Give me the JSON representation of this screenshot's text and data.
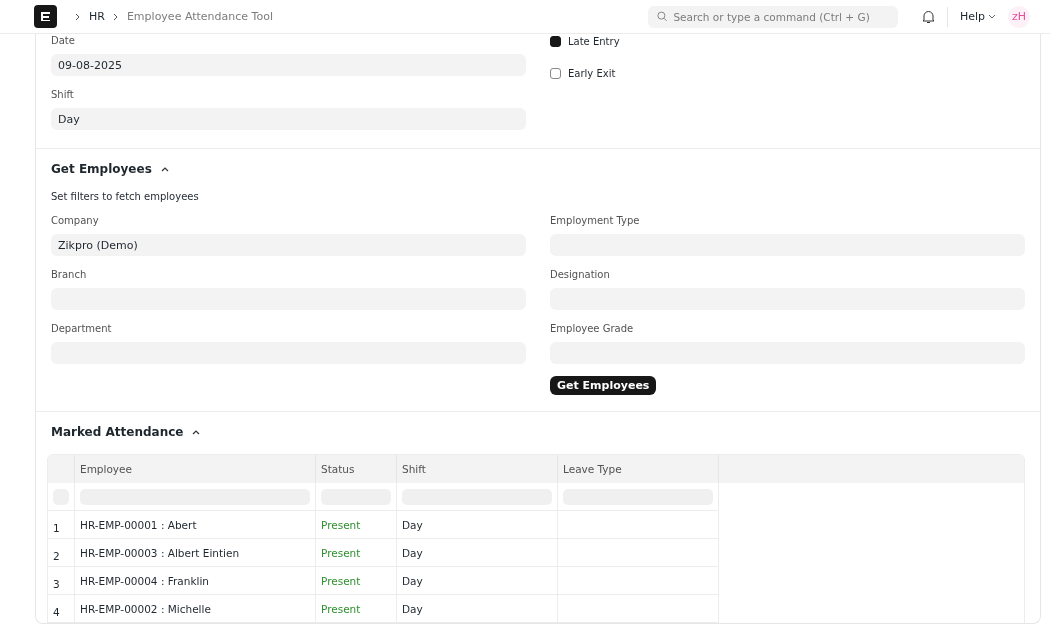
{
  "navbar": {
    "breadcrumbs": [
      "HR",
      "Employee Attendance Tool"
    ],
    "search": {
      "placeholder": "Search or type a command (Ctrl + G)"
    },
    "help": "Help",
    "avatar": "zH"
  },
  "top_section": {
    "fields": [
      {
        "label": "Date",
        "value": "09-08-2025"
      },
      {
        "label": "Shift",
        "value": "Day"
      }
    ],
    "checks": [
      {
        "label": "Late Entry",
        "checked": true
      },
      {
        "label": "Early Exit",
        "checked": false
      }
    ]
  },
  "get_employees": {
    "title": "Get Employees",
    "expanded": true,
    "hint": "Set filters to fetch employees",
    "left_fields": [
      {
        "label": "Company",
        "value": "Zikpro (Demo)"
      },
      {
        "label": "Branch"
      },
      {
        "label": "Department"
      }
    ],
    "right_fields": [
      {
        "label": "Employment Type"
      },
      {
        "label": "Designation"
      },
      {
        "label": "Employee Grade"
      }
    ],
    "button": "Get Employees"
  },
  "marked_attendance": {
    "title": "Marked Attendance",
    "expanded": true,
    "columns": [
      "Employee",
      "Status",
      "Shift",
      "Leave Type"
    ],
    "rows": [
      {
        "index": "1",
        "employee": "HR-EMP-00001 : Abert",
        "status": "Present",
        "shift": "Day"
      },
      {
        "index": "2",
        "employee": "HR-EMP-00003 : Albert Eintien",
        "status": "Present",
        "shift": "Day"
      },
      {
        "index": "3",
        "employee": "HR-EMP-00004 : Franklin",
        "status": "Present",
        "shift": "Day"
      },
      {
        "index": "4",
        "employee": "HR-EMP-00002 : Michelle",
        "status": "Present",
        "shift": "Day"
      }
    ]
  }
}
